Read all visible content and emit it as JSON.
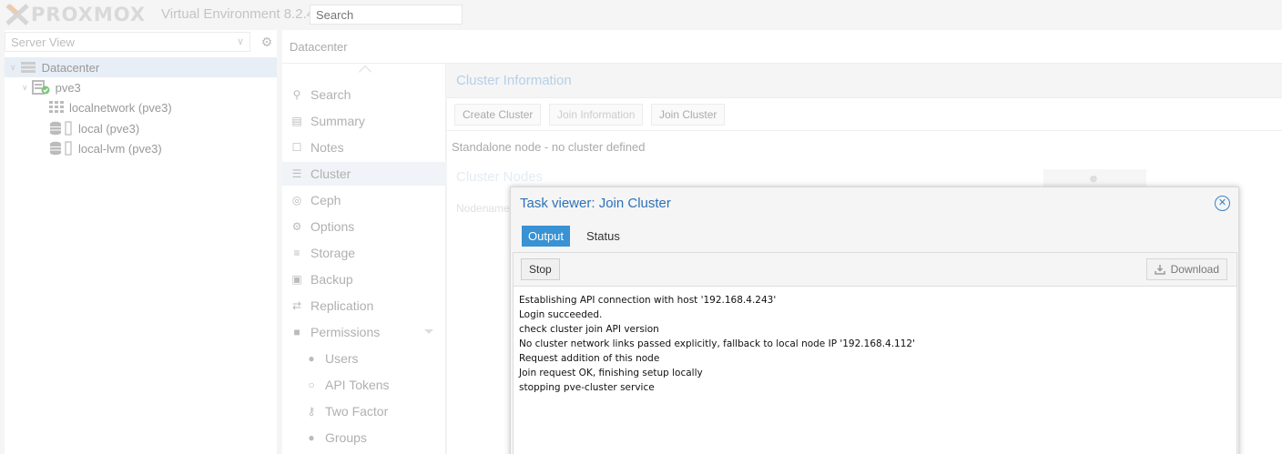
{
  "app": {
    "logo_text": "PROXMOX",
    "title": "Virtual Environment 8.2.4",
    "search_placeholder": "Search"
  },
  "left_panel": {
    "view_selector": "Server View",
    "tree": [
      {
        "label": "Datacenter",
        "icon": "datacenter-icon"
      },
      {
        "label": "pve3",
        "icon": "node-online-icon"
      },
      {
        "label": "localnetwork (pve3)",
        "icon": "network-grid-icon"
      },
      {
        "label": "local (pve3)",
        "icon": "storage-icon"
      },
      {
        "label": "local-lvm (pve3)",
        "icon": "storage-icon"
      }
    ]
  },
  "header": {
    "breadcrumb": "Datacenter"
  },
  "nav": {
    "items": [
      {
        "label": "Search",
        "icon": "search-icon"
      },
      {
        "label": "Summary",
        "icon": "book-icon"
      },
      {
        "label": "Notes",
        "icon": "notes-icon"
      },
      {
        "label": "Cluster",
        "icon": "server-icon"
      },
      {
        "label": "Ceph",
        "icon": "ceph-icon"
      },
      {
        "label": "Options",
        "icon": "gear-icon"
      },
      {
        "label": "Storage",
        "icon": "database-icon"
      },
      {
        "label": "Backup",
        "icon": "floppy-icon"
      },
      {
        "label": "Replication",
        "icon": "retweet-icon"
      },
      {
        "label": "Permissions",
        "icon": "unlock-icon"
      },
      {
        "label": "Users",
        "icon": "user-icon"
      },
      {
        "label": "API Tokens",
        "icon": "user-outline-icon"
      },
      {
        "label": "Two Factor",
        "icon": "key-icon"
      },
      {
        "label": "Groups",
        "icon": "users-icon"
      }
    ]
  },
  "cluster": {
    "info_title": "Cluster Information",
    "create_button": "Create Cluster",
    "join_info_button": "Join Information",
    "join_button": "Join Cluster",
    "status_text": "Standalone node - no cluster defined",
    "nodes_title": "Cluster Nodes",
    "nodename_column": "Nodename"
  },
  "task_viewer": {
    "title": "Task viewer: Join Cluster",
    "tabs": {
      "output": "Output",
      "status": "Status"
    },
    "stop_button": "Stop",
    "download_button": "Download",
    "log": [
      "Establishing API connection with host '192.168.4.243'",
      "Login succeeded.",
      "check cluster join API version",
      "No cluster network links passed explicitly, fallback to local node IP '192.168.4.112'",
      "Request addition of this node",
      "Join request OK, finishing setup locally",
      "stopping pve-cluster service"
    ]
  },
  "colors": {
    "accent": "#3892d3",
    "title_blue": "#2c72b8",
    "logo_orange": "#e57000"
  }
}
